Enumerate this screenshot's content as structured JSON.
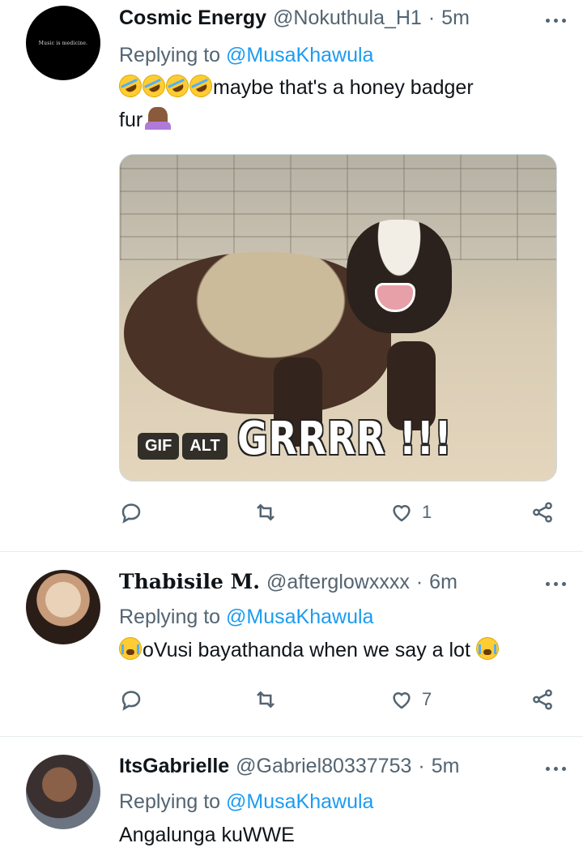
{
  "tweets": [
    {
      "avatar_text": "Music is medicine.",
      "display_name": "Cosmic Energy",
      "handle": "@Nokuthula_H1",
      "separator": "·",
      "time": "5m",
      "replying_prefix": "Replying to",
      "replying_to": "@MusaKhawula",
      "text_line1": "maybe that's a honey badger",
      "text_line2": "fur",
      "media": {
        "caption": "GRRRR !!!",
        "gif_badge": "GIF",
        "alt_badge": "ALT"
      },
      "like_count": "1"
    },
    {
      "display_name": "Thabisile M.",
      "handle": "@afterglowxxxx",
      "separator": "·",
      "time": "6m",
      "replying_prefix": "Replying to",
      "replying_to": "@MusaKhawula",
      "text": "oVusi bayathanda when we say a lot",
      "like_count": "7"
    },
    {
      "display_name": "ItsGabrielle",
      "handle": "@Gabriel80337753",
      "separator": "·",
      "time": "5m",
      "replying_prefix": "Replying to",
      "replying_to": "@MusaKhawula",
      "text": "Angalunga kuWWE"
    }
  ],
  "icons": [
    "more-icon",
    "reply-icon",
    "retweet-icon",
    "like-icon",
    "share-icon"
  ],
  "colors": {
    "link": "#1d9bf0",
    "secondary_text": "#536471",
    "divider": "#e6ecf0"
  }
}
